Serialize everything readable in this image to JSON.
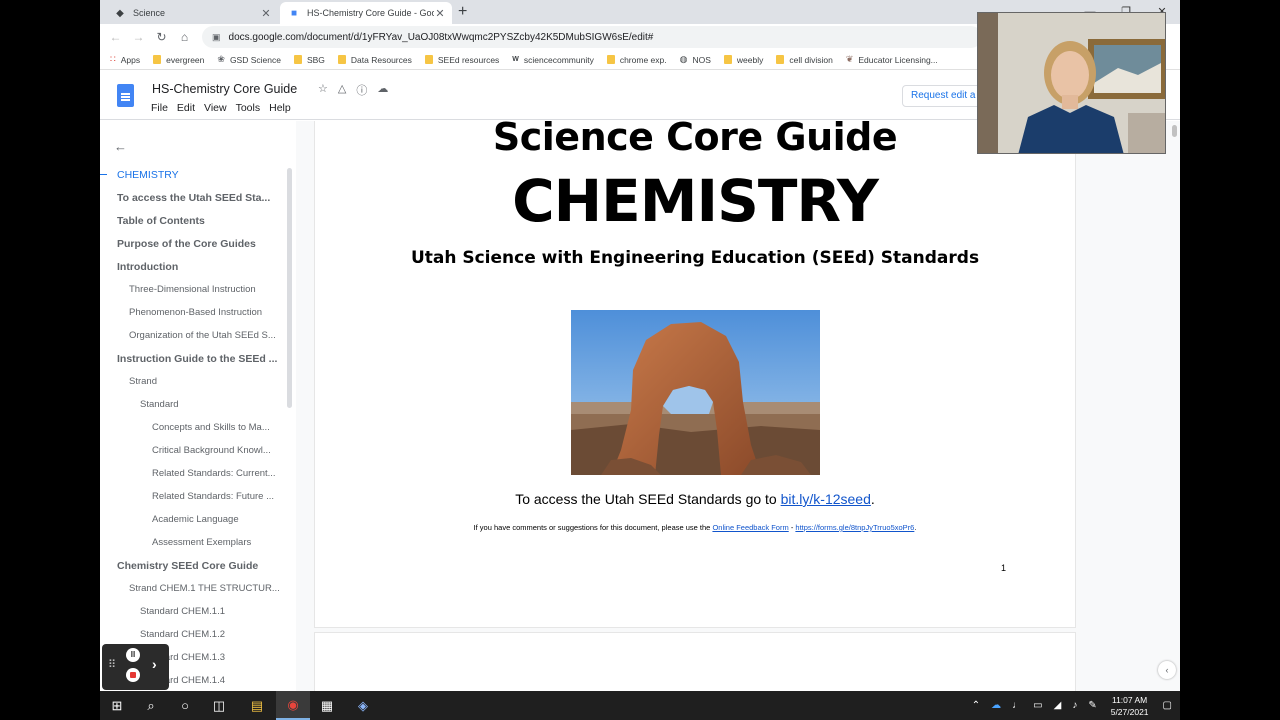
{
  "browser": {
    "tabs": [
      {
        "label": "Science",
        "icon": "drop-icon",
        "active": false
      },
      {
        "label": "HS-Chemistry Core Guide - Goog",
        "icon": "docs-icon",
        "active": true
      }
    ],
    "new_tab": "+",
    "url": "docs.google.com/document/d/1yFRYav_UaOJ08txWwqmc2PYSZcby42K5DMubSIGW6sE/edit#",
    "bookmarks": [
      {
        "label": "Apps",
        "icon": "apps-grid-icon"
      },
      {
        "label": "evergreen",
        "icon": "folder-icon"
      },
      {
        "label": "GSD Science",
        "icon": "leaf-icon"
      },
      {
        "label": "SBG",
        "icon": "folder-icon"
      },
      {
        "label": "Data Resources",
        "icon": "folder-icon"
      },
      {
        "label": "SEEd resources",
        "icon": "folder-icon"
      },
      {
        "label": "sciencecommunity",
        "icon": "wix-icon"
      },
      {
        "label": "chrome exp.",
        "icon": "folder-icon"
      },
      {
        "label": "NOS",
        "icon": "globe-icon"
      },
      {
        "label": "weebly",
        "icon": "folder-icon"
      },
      {
        "label": "cell division",
        "icon": "folder-icon"
      },
      {
        "label": "Educator Licensing...",
        "icon": "crest-icon"
      }
    ]
  },
  "docs": {
    "title": "HS-Chemistry Core Guide",
    "menu": [
      "File",
      "Edit",
      "View",
      "Tools",
      "Help"
    ],
    "request_edit": "Request edit a"
  },
  "outline": {
    "items": [
      {
        "label": "CHEMISTRY",
        "level": 1,
        "active": true
      },
      {
        "label": "To access the Utah SEEd Sta...",
        "level": 1
      },
      {
        "label": "Table of Contents",
        "level": 1
      },
      {
        "label": "Purpose of the Core Guides",
        "level": 1
      },
      {
        "label": "Introduction",
        "level": 1
      },
      {
        "label": "Three-Dimensional Instruction",
        "level": 2
      },
      {
        "label": "Phenomenon-Based Instruction",
        "level": 2
      },
      {
        "label": "Organization of the Utah SEEd S...",
        "level": 2
      },
      {
        "label": "Instruction Guide to the SEEd ...",
        "level": 1
      },
      {
        "label": "Strand",
        "level": 2
      },
      {
        "label": "Standard",
        "level": 3
      },
      {
        "label": "Concepts and Skills to Ma...",
        "level": 4
      },
      {
        "label": "Critical Background Knowl...",
        "level": 4
      },
      {
        "label": "Related Standards: Current...",
        "level": 4
      },
      {
        "label": "Related Standards: Future ...",
        "level": 4
      },
      {
        "label": "Academic Language",
        "level": 4
      },
      {
        "label": "Assessment Exemplars",
        "level": 4
      },
      {
        "label": "Chemistry SEEd Core Guide",
        "level": 1
      },
      {
        "label": "Strand CHEM.1 THE STRUCTUR...",
        "level": 2
      },
      {
        "label": "Standard CHEM.1.1",
        "level": 3
      },
      {
        "label": "Standard CHEM.1.2",
        "level": 3
      },
      {
        "label": "Standard CHEM.1.3",
        "level": 3
      },
      {
        "label": "Standard CHEM.1.4",
        "level": 3
      }
    ]
  },
  "page": {
    "heading1": "Science Core Guide",
    "heading2": "CHEMISTRY",
    "heading3": "Utah Science with Engineering Education (SEEd) Standards",
    "access_prefix": "To access the Utah SEEd Standards go to ",
    "access_link": "bit.ly/k-12seed",
    "access_suffix": ".",
    "feedback_prefix": "If you have comments or suggestions for this document, please use the ",
    "feedback_link1": "Online Feedback Form",
    "feedback_sep": " - ",
    "feedback_link2": "https://forms.gle/8tnpJyTrruo5xoPr6",
    "feedback_suffix": ".",
    "page_number": "1"
  },
  "taskbar": {
    "time": "11:07 AM",
    "date": "5/27/2021"
  },
  "colors": {
    "accent": "#1a73e8",
    "link": "#1155cc",
    "docs_blue": "#4285f4"
  }
}
